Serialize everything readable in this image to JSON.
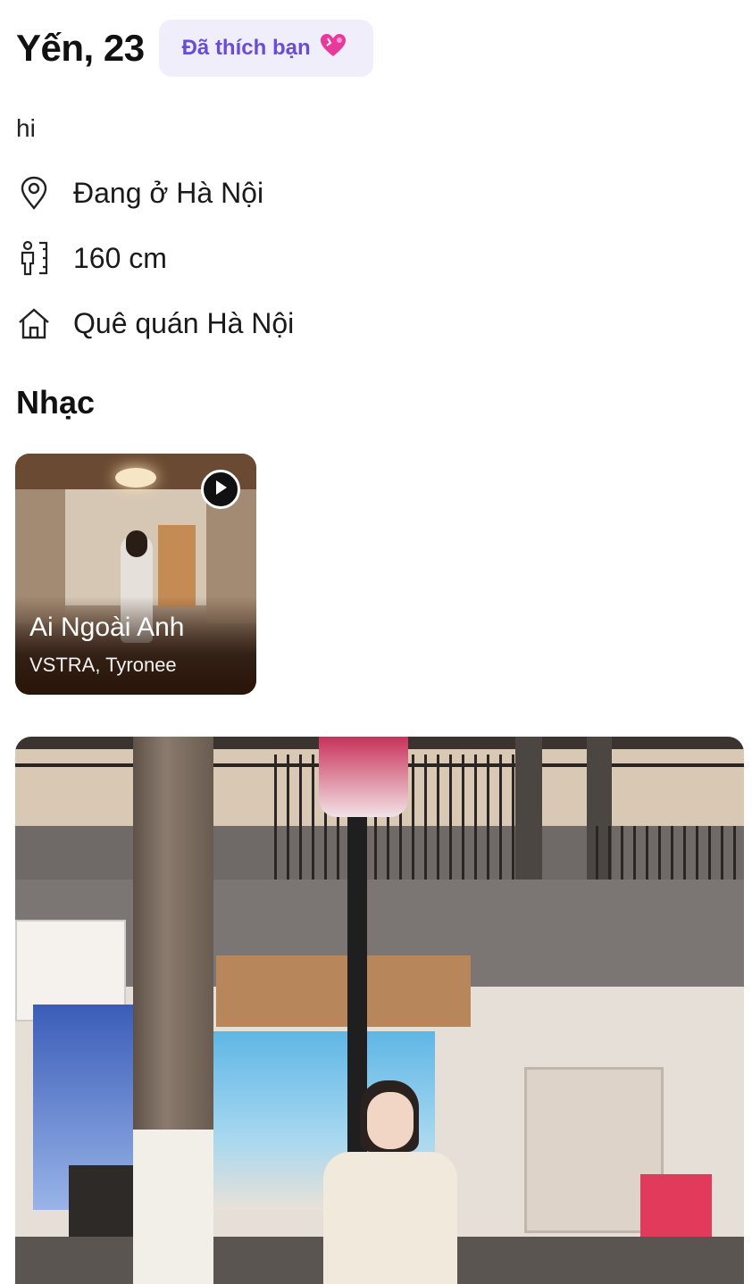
{
  "profile": {
    "name_age": "Yến, 23",
    "liked_badge": "Đã thích bạn",
    "bio": "hi",
    "location": "Đang ở Hà Nội",
    "height": "160 cm",
    "hometown": "Quê quán Hà Nội"
  },
  "music": {
    "section_title": "Nhạc",
    "song_title": "Ai Ngoài Anh",
    "artist": "VSTRA, Tyronee"
  },
  "icons": {
    "location": "location-pin-icon",
    "height": "height-ruler-icon",
    "hometown": "home-icon",
    "play": "play-icon",
    "heart": "heart-icon"
  },
  "colors": {
    "badge_bg": "#f1eefc",
    "badge_text": "#6a4dd6",
    "heart": "#e83a9a"
  }
}
